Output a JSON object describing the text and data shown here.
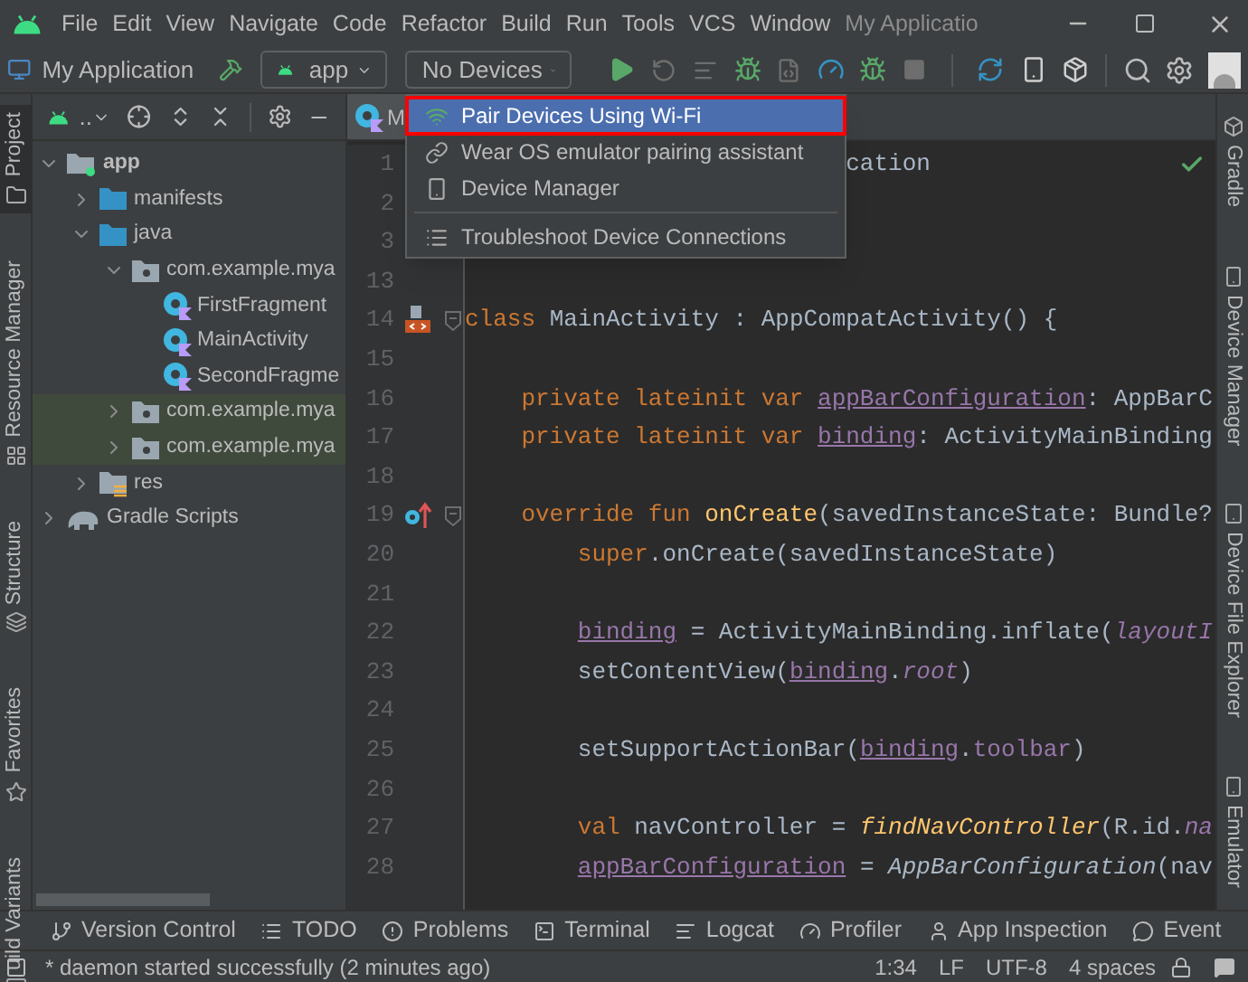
{
  "menu_bar": {
    "items": [
      "File",
      "Edit",
      "View",
      "Navigate",
      "Code",
      "Refactor",
      "Build",
      "Run",
      "Tools",
      "VCS",
      "Window"
    ],
    "title": "My Applicatio"
  },
  "toolbar": {
    "project": "My Application",
    "configuration": "app",
    "device": "No Devices"
  },
  "left_strip": [
    {
      "label": "Project",
      "selected": true
    },
    {
      "label": "Resource Manager",
      "selected": false
    },
    {
      "label": "Structure",
      "selected": false
    },
    {
      "label": "Favorites",
      "selected": false
    },
    {
      "label": "uild Variants",
      "selected": false
    }
  ],
  "project_panel": {
    "view": "..",
    "tree": [
      {
        "name": "app",
        "kind": "module",
        "expanded": true,
        "children": [
          {
            "name": "manifests",
            "kind": "folder",
            "expanded": false
          },
          {
            "name": "java",
            "kind": "folder",
            "expanded": true,
            "children": [
              {
                "name": "com.example.mya",
                "kind": "package",
                "expanded": true,
                "children": [
                  {
                    "name": "FirstFragment",
                    "kind": "class"
                  },
                  {
                    "name": "MainActivity",
                    "kind": "class"
                  },
                  {
                    "name": "SecondFragme",
                    "kind": "class"
                  }
                ]
              },
              {
                "name": "com.example.mya",
                "kind": "test-package",
                "expanded": false
              },
              {
                "name": "com.example.mya",
                "kind": "test-package",
                "expanded": false
              }
            ]
          },
          {
            "name": "res",
            "kind": "resources",
            "expanded": false
          }
        ]
      },
      {
        "name": "Gradle Scripts",
        "kind": "gradle",
        "expanded": false
      }
    ]
  },
  "editor": {
    "tabs": [
      {
        "label": "M",
        "selected": true
      }
    ],
    "lines": [
      {
        "number": "1",
        "kind": "partial",
        "segments": [
          {
            "text": "cation",
            "kind": "plain"
          }
        ]
      },
      {
        "number": "2",
        "kind": "top"
      },
      {
        "number": "3",
        "kind": "top"
      },
      {
        "number": "13",
        "kind": "top"
      },
      {
        "number": "14",
        "kind": "top",
        "layout_marker": true,
        "fold": true,
        "segments": [
          {
            "text": "class",
            "kind": "keyword"
          },
          {
            "text": " MainActivity : AppCompatActivity() {",
            "kind": "plain"
          }
        ]
      },
      {
        "number": "15",
        "kind": "top"
      },
      {
        "number": "16",
        "kind": "member",
        "segments": [
          {
            "text": "private lateinit var ",
            "kind": "keyword"
          },
          {
            "text": "appBarConfiguration",
            "kind": "property"
          },
          {
            "text": ": AppBarC",
            "kind": "plain"
          }
        ]
      },
      {
        "number": "17",
        "kind": "member",
        "segments": [
          {
            "text": "private lateinit var ",
            "kind": "keyword"
          },
          {
            "text": "binding",
            "kind": "property"
          },
          {
            "text": ": ActivityMainBinding",
            "kind": "plain"
          }
        ]
      },
      {
        "number": "18",
        "kind": "top"
      },
      {
        "number": "19",
        "kind": "member",
        "override_marker": true,
        "fold": true,
        "segments": [
          {
            "text": "override fun ",
            "kind": "keyword"
          },
          {
            "text": "onCreate",
            "kind": "declaration"
          },
          {
            "text": "(savedInstanceState: Bundle?",
            "kind": "plain"
          }
        ]
      },
      {
        "number": "20",
        "kind": "body",
        "segments": [
          {
            "text": "super",
            "kind": "keyword"
          },
          {
            "text": ".onCreate(savedInstanceState)",
            "kind": "plain"
          }
        ]
      },
      {
        "number": "21",
        "kind": "top"
      },
      {
        "number": "22",
        "kind": "body",
        "segments": [
          {
            "text": "binding",
            "kind": "property"
          },
          {
            "text": " = ActivityMainBinding.inflate(",
            "kind": "plain"
          },
          {
            "text": "layoutI",
            "kind": "italic-property"
          }
        ]
      },
      {
        "number": "23",
        "kind": "body",
        "segments": [
          {
            "text": "setContentView(",
            "kind": "plain"
          },
          {
            "text": "binding",
            "kind": "property"
          },
          {
            "text": ".",
            "kind": "plain"
          },
          {
            "text": "root",
            "kind": "italic-property"
          },
          {
            "text": ")",
            "kind": "plain"
          }
        ]
      },
      {
        "number": "24",
        "kind": "top"
      },
      {
        "number": "25",
        "kind": "body",
        "segments": [
          {
            "text": "setSupportActionBar(",
            "kind": "plain"
          },
          {
            "text": "binding",
            "kind": "property"
          },
          {
            "text": ".",
            "kind": "plain"
          },
          {
            "text": "toolbar",
            "kind": "field"
          },
          {
            "text": ")",
            "kind": "plain"
          }
        ]
      },
      {
        "number": "26",
        "kind": "top"
      },
      {
        "number": "27",
        "kind": "body",
        "segments": [
          {
            "text": "val",
            "kind": "keyword"
          },
          {
            "text": " navController = ",
            "kind": "plain"
          },
          {
            "text": "findNavController",
            "kind": "italic-call"
          },
          {
            "text": "(R.id.",
            "kind": "plain"
          },
          {
            "text": "na",
            "kind": "italic-property"
          }
        ]
      },
      {
        "number": "28",
        "kind": "body",
        "segments": [
          {
            "text": "appBarConfiguration",
            "kind": "property"
          },
          {
            "text": " = ",
            "kind": "plain"
          },
          {
            "text": "AppBarConfiguration",
            "kind": "italic-plain"
          },
          {
            "text": "(nav",
            "kind": "plain"
          }
        ]
      }
    ]
  },
  "right_strip": [
    {
      "label": "Gradle",
      "selected": false
    },
    {
      "label": "Device Manager",
      "selected": false
    },
    {
      "label": "Device File Explorer",
      "selected": false
    },
    {
      "label": "Emulator",
      "selected": false
    }
  ],
  "device_menu": {
    "items": [
      {
        "label": "Pair Devices Using Wi-Fi",
        "selected": true,
        "separator_before": false
      },
      {
        "label": "Wear OS emulator pairing assistant",
        "selected": false,
        "separator_before": false
      },
      {
        "label": "Device Manager",
        "selected": false,
        "separator_before": false
      },
      {
        "label": "Troubleshoot Device Connections",
        "selected": false,
        "separator_before": true
      }
    ]
  },
  "tool_windows": [
    "Version Control",
    "TODO",
    "Problems",
    "Terminal",
    "Logcat",
    "Profiler",
    "App Inspection",
    "Event"
  ],
  "status_bar": {
    "message": "* daemon started successfully (2 minutes ago)",
    "position": "1:34",
    "line_separator": "LF",
    "encoding": "UTF-8",
    "indent": "4 spaces"
  }
}
